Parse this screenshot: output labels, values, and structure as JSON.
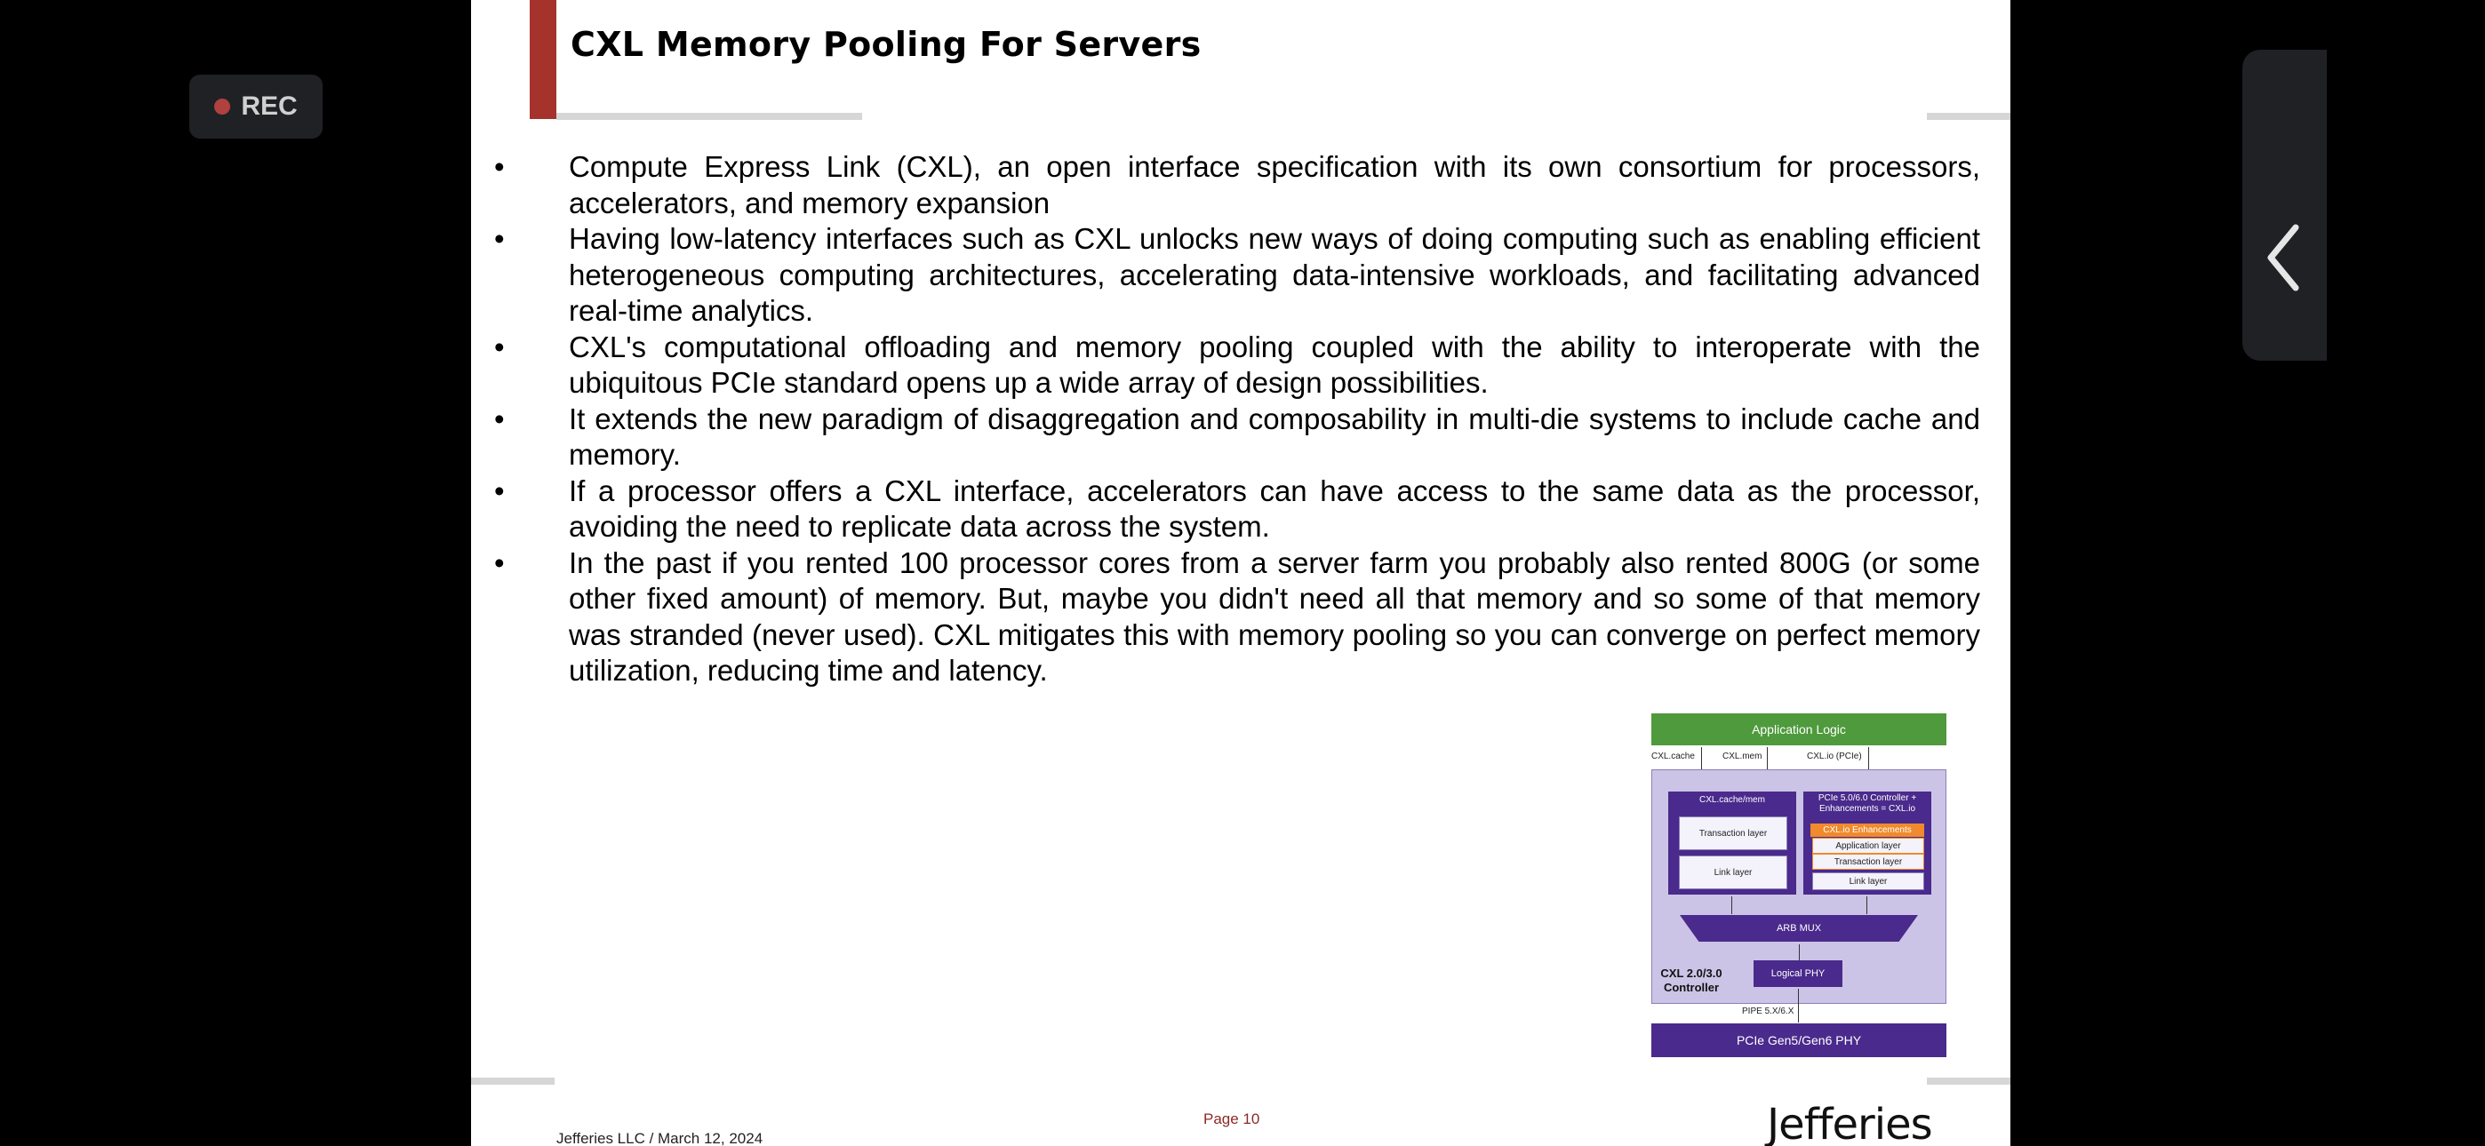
{
  "overlay": {
    "rec_label": "REC"
  },
  "slide": {
    "title": "CXL Memory Pooling For Servers",
    "bullet_glyph": "•",
    "bullets": [
      "Compute Express Link (CXL), an open interface specification with its own consortium for processors, accelerators, and memory expansion",
      "Having low-latency interfaces such as CXL unlocks new ways of doing computing such as enabling efficient heterogeneous computing architectures, accelerating data-intensive workloads, and facilitating advanced real-time analytics.",
      "CXL's computational offloading and memory pooling coupled with the ability to interoperate with the ubiquitous PCIe standard opens up a wide array of design possibilities.",
      "It extends the new paradigm of disaggregation and composability in multi-die systems to include cache and memory.",
      "If a processor offers a CXL interface, accelerators can have access to the same data as the processor, avoiding the need to replicate data across the system.",
      "In the past if you rented 100 processor cores from a server farm you probably also rented 800G (or some other fixed amount) of memory. But, maybe you didn't need all that memory and so some of that memory was stranded (never used). CXL mitigates this with memory pooling so you can converge on perfect memory utilization, reducing time and latency."
    ],
    "diagram": {
      "application_logic": "Application Logic",
      "cxl_cache": "CXL.cache",
      "cxl_mem": "CXL.mem",
      "cxl_io": "CXL.io (PCIe)",
      "cachemem_title": "CXL.cache/mem",
      "transaction_layer": "Transaction layer",
      "link_layer": "Link layer",
      "pcie_ctrl_title": "PCIe 5.0/6.0 Controller + Enhancements = CXL.io",
      "io_enhancements": "CXL.io Enhancements",
      "application_layer": "Application layer",
      "io_transaction_layer": "Transaction layer",
      "io_link_layer": "Link layer",
      "arb_mux": "ARB MUX",
      "controller_label": "CXL 2.0/3.0 Controller",
      "logical_phy": "Logical PHY",
      "pipe": "PIPE 5.X/6.X",
      "pcie_phy": "PCIe Gen5/Gen6 PHY"
    },
    "page_label": "Page 10",
    "footer_left": "Jefferies LLC /  March 12, 2024",
    "logo": "Jefferies"
  },
  "colors": {
    "accent_red": "#a5332c",
    "diagram_green": "#4e9a3c",
    "diagram_purple": "#4a2a8c",
    "diagram_lavender": "#ccc4e6",
    "diagram_orange": "#f08a2c"
  }
}
